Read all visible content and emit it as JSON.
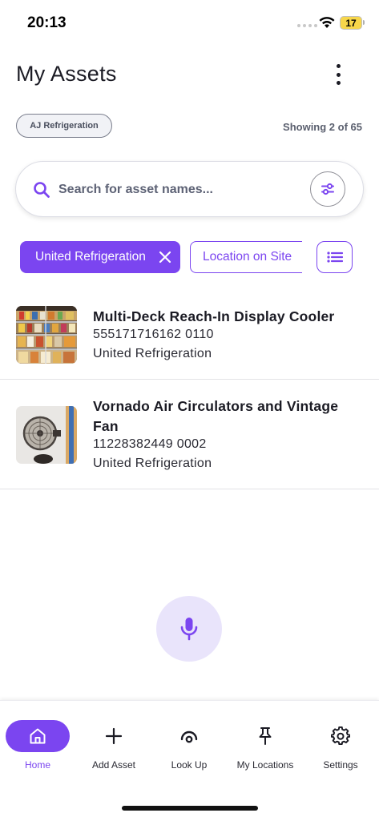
{
  "status_bar": {
    "time": "20:13",
    "battery": "17"
  },
  "header": {
    "title": "My Assets"
  },
  "company_chip": "AJ Refrigeration",
  "result_count": "Showing 2 of 65",
  "search": {
    "placeholder": "Search for asset names...",
    "value": ""
  },
  "filters": {
    "active_filter": "United Refrigeration",
    "location_filter": "Location on Site"
  },
  "assets": [
    {
      "name": "Multi-Deck Reach-In Display Cooler",
      "serial": "555171716162 0110",
      "manufacturer": "United Refrigeration"
    },
    {
      "name": "Vornado Air Circulators and Vintage Fan",
      "serial": "11228382449 0002",
      "manufacturer": "United Refrigeration"
    }
  ],
  "tabs": [
    {
      "label": "Home",
      "icon": "home-icon",
      "active": true
    },
    {
      "label": "Add Asset",
      "icon": "plus-icon"
    },
    {
      "label": "Look Up",
      "icon": "look-up-icon"
    },
    {
      "label": "My Locations",
      "icon": "pin-icon"
    },
    {
      "label": "Settings",
      "icon": "gear-icon"
    }
  ],
  "colors": {
    "accent": "#7b45f0",
    "accent_light": "#e9e4fb",
    "text": "#1b1b24"
  }
}
